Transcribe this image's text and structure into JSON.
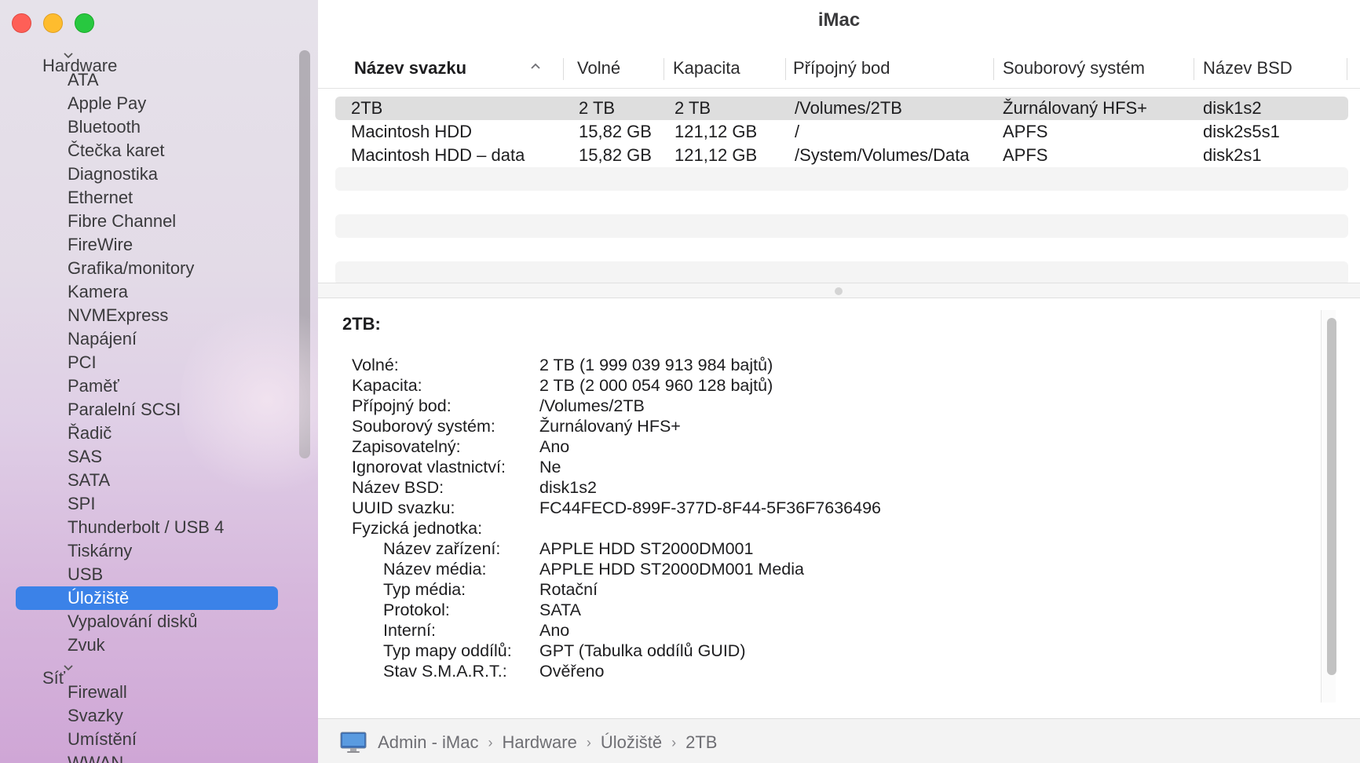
{
  "window": {
    "title": "iMac"
  },
  "sidebar": {
    "groups": [
      {
        "label": "Hardware",
        "items": [
          "ATA",
          "Apple Pay",
          "Bluetooth",
          "Čtečka karet",
          "Diagnostika",
          "Ethernet",
          "Fibre Channel",
          "FireWire",
          "Grafika/monitory",
          "Kamera",
          "NVMExpress",
          "Napájení",
          "PCI",
          "Paměť",
          "Paralelní SCSI",
          "Řadič",
          "SAS",
          "SATA",
          "SPI",
          "Thunderbolt / USB 4",
          "Tiskárny",
          "USB",
          "Úložiště",
          "Vypalování disků",
          "Zvuk"
        ]
      },
      {
        "label": "Síť",
        "items": [
          "Firewall",
          "Svazky",
          "Umístění",
          "WWAN"
        ]
      }
    ],
    "selected": "Úložiště"
  },
  "table": {
    "columns": [
      "Název svazku",
      "Volné",
      "Kapacita",
      "Přípojný bod",
      "Souborový systém",
      "Název BSD"
    ],
    "rows": [
      [
        "2TB",
        "2 TB",
        "2 TB",
        "/Volumes/2TB",
        "Žurnálovaný HFS+",
        "disk1s2"
      ],
      [
        "Macintosh HDD",
        "15,82 GB",
        "121,12 GB",
        "/",
        "APFS",
        "disk2s5s1"
      ],
      [
        "Macintosh HDD – data",
        "15,82 GB",
        "121,12 GB",
        "/System/Volumes/Data",
        "APFS",
        "disk2s1"
      ]
    ]
  },
  "detail": {
    "title": "2TB:",
    "props": [
      {
        "key": "Volné:",
        "value": "2 TB (1 999 039 913 984 bajtů)"
      },
      {
        "key": "Kapacita:",
        "value": "2 TB (2 000 054 960 128 bajtů)"
      },
      {
        "key": "Přípojný bod:",
        "value": "/Volumes/2TB"
      },
      {
        "key": "Souborový systém:",
        "value": "Žurnálovaný HFS+"
      },
      {
        "key": "Zapisovatelný:",
        "value": "Ano"
      },
      {
        "key": "Ignorovat vlastnictví:",
        "value": "Ne"
      },
      {
        "key": "Název BSD:",
        "value": "disk1s2"
      },
      {
        "key": "UUID svazku:",
        "value": "FC44FECD-899F-377D-8F44-5F36F7636496"
      },
      {
        "key": "Fyzická jednotka:",
        "value": ""
      }
    ],
    "physical": [
      {
        "key": "Název zařízení:",
        "value": "APPLE HDD ST2000DM001"
      },
      {
        "key": "Název média:",
        "value": "APPLE HDD ST2000DM001 Media"
      },
      {
        "key": "Typ média:",
        "value": "Rotační"
      },
      {
        "key": "Protokol:",
        "value": "SATA"
      },
      {
        "key": "Interní:",
        "value": "Ano"
      },
      {
        "key": "Typ mapy oddílů:",
        "value": "GPT (Tabulka oddílů GUID)"
      },
      {
        "key": "Stav S.M.A.R.T.:",
        "value": "Ověřeno"
      }
    ]
  },
  "pathbar": {
    "icon": "imac-icon",
    "crumbs": [
      "Admin - iMac",
      "Hardware",
      "Úložiště",
      "2TB"
    ]
  },
  "colors": {
    "selection": "#3b82e8",
    "close": "#fe5f57",
    "minimize": "#febc2e",
    "zoom": "#28c840"
  }
}
